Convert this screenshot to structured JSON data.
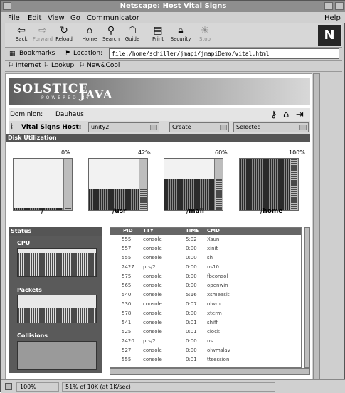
{
  "window": {
    "title": "Netscape: Host Vital Signs"
  },
  "menubar": {
    "items": [
      "File",
      "Edit",
      "View",
      "Go",
      "Communicator"
    ],
    "help": "Help"
  },
  "toolbar": {
    "buttons": [
      {
        "label": "Back",
        "icon": "back-arrow-icon",
        "enabled": true
      },
      {
        "label": "Forward",
        "icon": "forward-arrow-icon",
        "enabled": false
      },
      {
        "label": "Reload",
        "icon": "reload-icon",
        "enabled": true
      },
      {
        "label": "Home",
        "icon": "home-icon",
        "enabled": true
      },
      {
        "label": "Search",
        "icon": "search-icon",
        "enabled": true
      },
      {
        "label": "Guide",
        "icon": "guide-icon",
        "enabled": true
      },
      {
        "label": "Print",
        "icon": "print-icon",
        "enabled": true
      },
      {
        "label": "Security",
        "icon": "lock-icon",
        "enabled": true
      },
      {
        "label": "Stop",
        "icon": "stop-icon",
        "enabled": false
      }
    ],
    "logo": "N"
  },
  "location": {
    "bookmarks_label": "Bookmarks",
    "location_label": "Location:",
    "url": "file:/home/schiller/jmapi/jmapiDemo/vital.html"
  },
  "personal": {
    "items": [
      "Internet",
      "Lookup",
      "New&Cool"
    ]
  },
  "banner": {
    "line1": "SOLSTICE",
    "line2": "JAVA",
    "powered": "POWERED BY"
  },
  "domain": {
    "label": "Dominion:",
    "value": "Dauhaus"
  },
  "hostbar": {
    "label": "Vital Signs Host:",
    "host": "unity2",
    "action": "Create",
    "filter": "Selected"
  },
  "disk": {
    "title": "Disk Utilization",
    "items": [
      {
        "mount": "/",
        "percent": "0%",
        "level": 0.02
      },
      {
        "mount": "/usr",
        "percent": "42%",
        "level": 0.42
      },
      {
        "mount": "/mail",
        "percent": "60%",
        "level": 0.6
      },
      {
        "mount": "/home",
        "percent": "100%",
        "level": 1.0
      }
    ]
  },
  "status": {
    "title": "Status",
    "graphs": [
      "CPU",
      "Packets",
      "Collisions"
    ]
  },
  "processes": {
    "headers": [
      "PID",
      "TTY",
      "TIME",
      "CMD"
    ],
    "rows": [
      [
        "555",
        "console",
        "5:02",
        "Xsun"
      ],
      [
        "557",
        "console",
        "0:00",
        "xinit"
      ],
      [
        "555",
        "console",
        "0:00",
        "sh"
      ],
      [
        "2427",
        "pts/2",
        "0:00",
        "ns10"
      ],
      [
        "575",
        "console",
        "0:00",
        "fbconsol"
      ],
      [
        "565",
        "console",
        "0:00",
        "openwin"
      ],
      [
        "540",
        "console",
        "5:16",
        "xsmeasit"
      ],
      [
        "530",
        "console",
        "0:07",
        "olwm"
      ],
      [
        "578",
        "console",
        "0:00",
        "xterm"
      ],
      [
        "541",
        "console",
        "0:01",
        "shiff"
      ],
      [
        "525",
        "console",
        "0:01",
        "clock"
      ],
      [
        "2420",
        "pts/2",
        "0:00",
        "ns"
      ],
      [
        "527",
        "console",
        "0:00",
        "olwmslav"
      ],
      [
        "555",
        "console",
        "0:01",
        "ttsession"
      ]
    ]
  },
  "statusbar": {
    "zoom": "100%",
    "message": "51% of 10K (at 1K/sec)"
  }
}
